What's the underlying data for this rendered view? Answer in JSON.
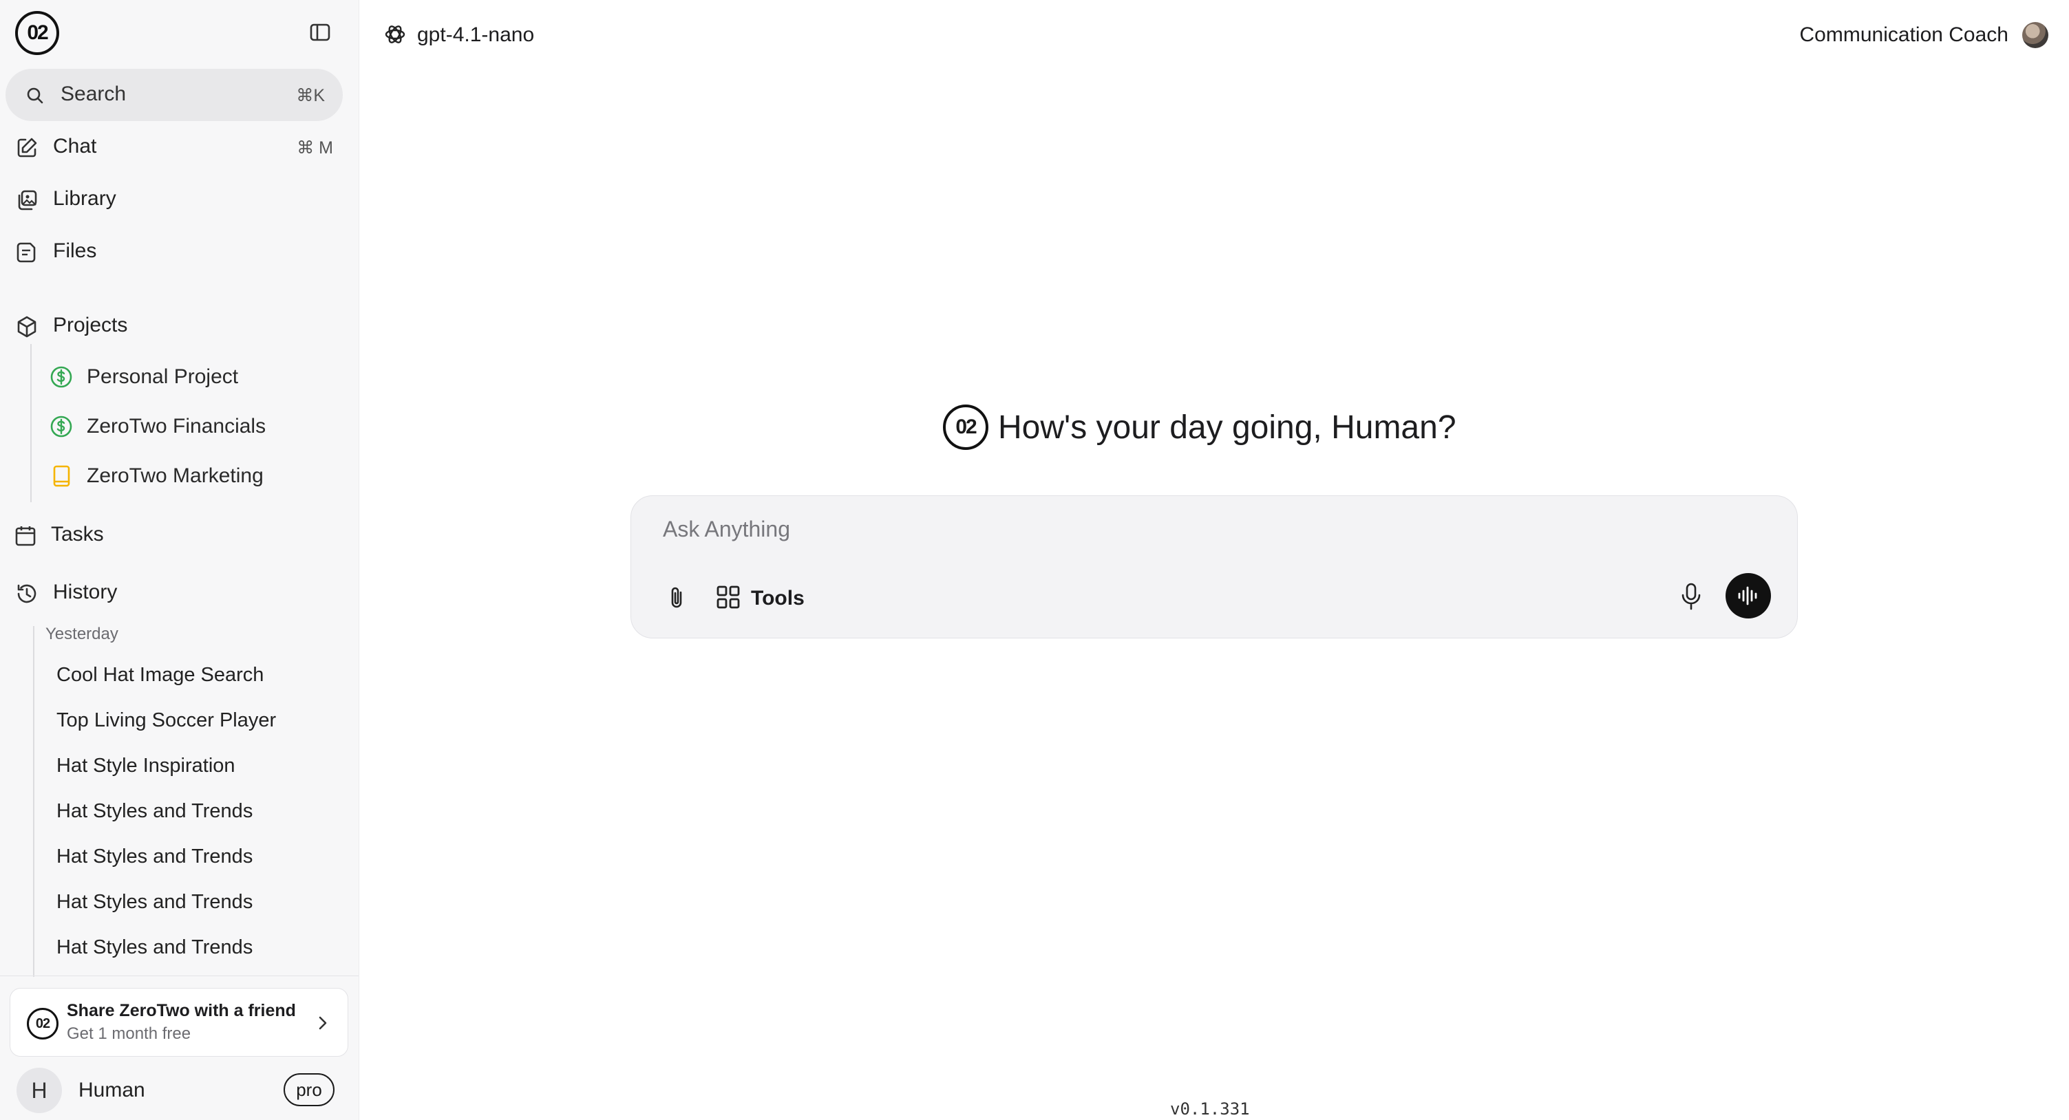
{
  "app": {
    "logo_text": "02"
  },
  "sidebar": {
    "search": {
      "label": "Search",
      "shortcut": "⌘K"
    },
    "nav": [
      {
        "label": "Chat",
        "shortcut": "⌘ M",
        "icon": "edit-icon"
      },
      {
        "label": "Library",
        "icon": "library-icon"
      },
      {
        "label": "Files",
        "icon": "file-icon"
      }
    ],
    "projects": {
      "label": "Projects",
      "items": [
        {
          "label": "Personal Project",
          "icon": "dollar-circle-icon",
          "color": "#34a853"
        },
        {
          "label": "ZeroTwo Financials",
          "icon": "dollar-circle-icon",
          "color": "#34a853"
        },
        {
          "label": "ZeroTwo Marketing",
          "icon": "book-icon",
          "color": "#f5b400"
        }
      ]
    },
    "tasks": {
      "label": "Tasks"
    },
    "history": {
      "label": "History",
      "group": "Yesterday",
      "items": [
        "Cool Hat Image Search",
        "Top Living Soccer Player",
        "Hat Style Inspiration",
        "Hat Styles and Trends",
        "Hat Styles and Trends",
        "Hat Styles and Trends",
        "Hat Styles and Trends"
      ]
    },
    "share": {
      "title": "Share ZeroTwo with a friend",
      "subtitle": "Get 1 month free",
      "badge": "02"
    },
    "user": {
      "initial": "H",
      "name": "Human",
      "plan": "pro"
    }
  },
  "header": {
    "model": "gpt-4.1-nano",
    "persona": "Communication Coach"
  },
  "main": {
    "greeting": "How's your day going, Human?",
    "composer": {
      "placeholder": "Ask Anything",
      "tools_label": "Tools"
    },
    "version": "v0.1.331"
  }
}
